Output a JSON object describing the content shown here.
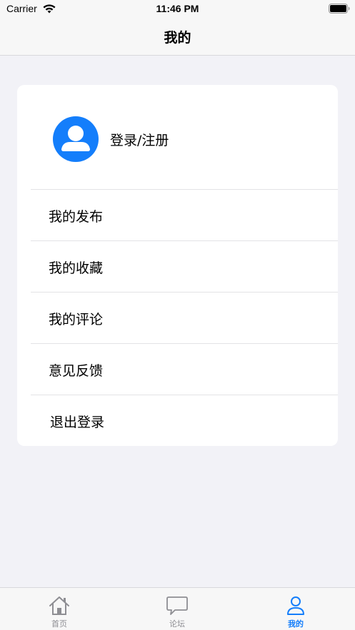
{
  "status_bar": {
    "carrier": "Carrier",
    "time": "11:46 PM",
    "wifi_icon": "wifi-icon",
    "battery_icon": "battery-icon"
  },
  "nav": {
    "title": "我的"
  },
  "profile": {
    "avatar_icon": "person-icon",
    "login_label": "登录/注册"
  },
  "menu": [
    {
      "label": "我的发布"
    },
    {
      "label": "我的收藏"
    },
    {
      "label": "我的评论"
    },
    {
      "label": "意见反馈"
    },
    {
      "label": "退出登录"
    }
  ],
  "tabs": [
    {
      "label": "首页",
      "icon": "home-icon",
      "active": false
    },
    {
      "label": "论坛",
      "icon": "chat-bubble-icon",
      "active": false
    },
    {
      "label": "我的",
      "icon": "person-icon",
      "active": true
    }
  ],
  "colors": {
    "accent": "#147efb",
    "background": "#f2f2f7",
    "inactive_tab": "#8e8e93"
  }
}
